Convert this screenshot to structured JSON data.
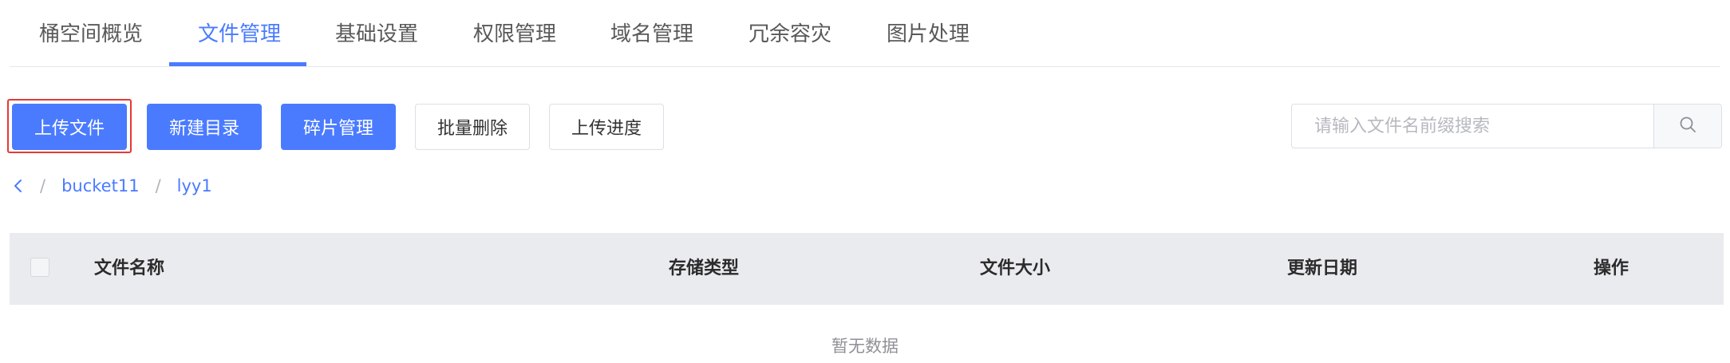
{
  "tabs": [
    {
      "label": "桶空间概览"
    },
    {
      "label": "文件管理"
    },
    {
      "label": "基础设置"
    },
    {
      "label": "权限管理"
    },
    {
      "label": "域名管理"
    },
    {
      "label": "冗余容灾"
    },
    {
      "label": "图片处理"
    }
  ],
  "active_tab": "文件管理",
  "toolbar": {
    "upload_label": "上传文件",
    "new_dir_label": "新建目录",
    "fragment_label": "碎片管理",
    "batch_delete_label": "批量删除",
    "upload_progress_label": "上传进度"
  },
  "search": {
    "placeholder": "请输入文件名前缀搜索",
    "value": ""
  },
  "breadcrumb": {
    "items": [
      {
        "label": "bucket11"
      },
      {
        "label": "lyy1"
      }
    ],
    "separator": "/"
  },
  "table": {
    "columns": [
      {
        "label": "文件名称"
      },
      {
        "label": "存储类型"
      },
      {
        "label": "文件大小"
      },
      {
        "label": "更新日期"
      },
      {
        "label": "操作"
      }
    ],
    "rows": [],
    "empty_text": "暂无数据"
  },
  "colors": {
    "accent": "#4a7bff",
    "highlight_border": "#e53935",
    "header_bg": "#eaebee"
  }
}
